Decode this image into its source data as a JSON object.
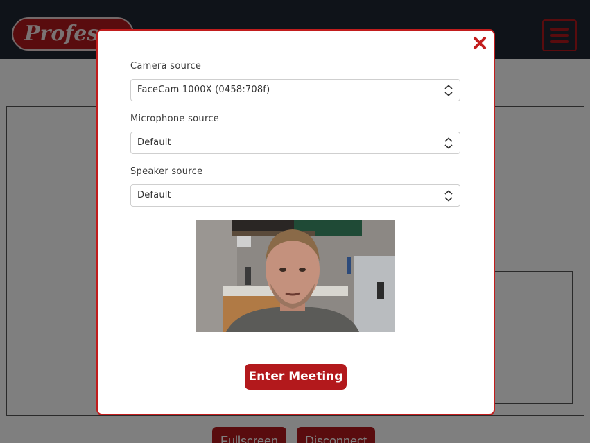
{
  "app": {
    "logo_text": "Professor",
    "menu_icon": "hamburger-menu-icon",
    "brand_color": "#b3191c"
  },
  "page": {
    "fullscreen_label": "Fullscreen",
    "disconnect_label": "Disconnect"
  },
  "modal": {
    "close_icon": "close-icon",
    "camera": {
      "label": "Camera source",
      "value": "FaceCam 1000X (0458:708f)"
    },
    "microphone": {
      "label": "Microphone source",
      "value": "Default"
    },
    "speaker": {
      "label": "Speaker source",
      "value": "Default"
    },
    "enter_label": "Enter Meeting"
  }
}
